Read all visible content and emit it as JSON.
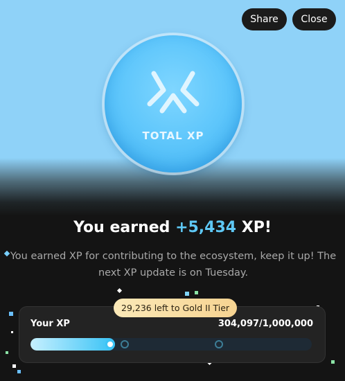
{
  "header": {
    "share_label": "Share",
    "close_label": "Close"
  },
  "badge": {
    "label": "TOTAL XP",
    "icon": "xp-logo-icon",
    "colors": {
      "coin": "#5ec6fb",
      "background": "#8fd2f8"
    }
  },
  "headline": {
    "prefix": "You earned ",
    "amount": "+5,434",
    "suffix": " XP!",
    "amount_color": "#5ec8f5"
  },
  "description": "You earned XP for contributing to the ecosystem, keep it up! The next XP update is on Tuesday.",
  "progress": {
    "tooltip": "29,236 left to Gold II Tier",
    "label": "Your XP",
    "value_text": "304,097/1,000,000",
    "fill_fraction": 0.3,
    "tier_markers": 2
  }
}
